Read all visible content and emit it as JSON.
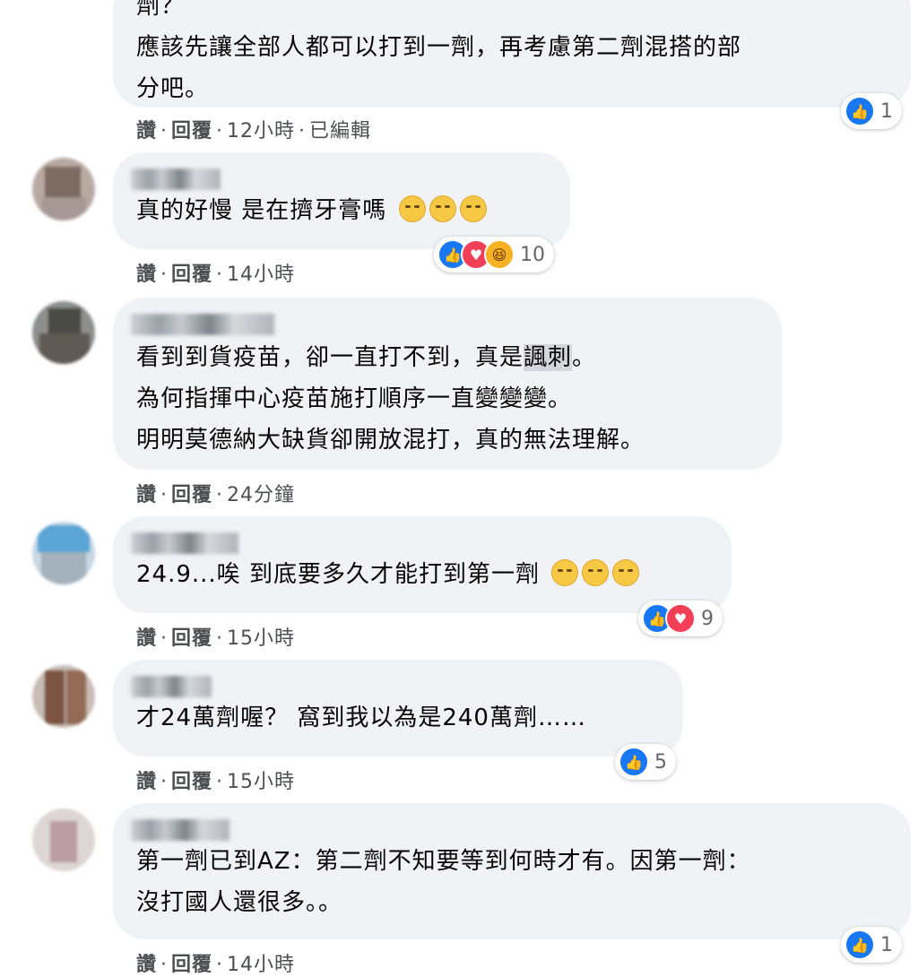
{
  "comments": [
    {
      "lines": [
        "劑？",
        "應該先讓全部人都可以打到一劑，再考慮第二劑混搭的部",
        "分吧。"
      ],
      "meta": {
        "like": "讚",
        "reply": "回覆",
        "time": "12小時",
        "edited": "已編輯"
      },
      "reactions": {
        "types": [
          "like"
        ],
        "count": "1"
      }
    },
    {
      "lines": [
        "真的好慢 是在擠牙膏嗎"
      ],
      "emojis": [
        "confused-face",
        "smirk-face",
        "smirk-face"
      ],
      "meta": {
        "like": "讚",
        "reply": "回覆",
        "time": "14小時"
      },
      "reactions": {
        "types": [
          "like",
          "love",
          "haha"
        ],
        "count": "10"
      }
    },
    {
      "line1_a": "看到到貨疫苗，卻一直打不到，真是",
      "line1_hl": "諷刺",
      "line1_b": "。",
      "lines": [
        "為何指揮中心疫苗施打順序一直變變變。",
        "明明莫德納大缺貨卻開放混打，真的無法理解。"
      ],
      "meta": {
        "like": "讚",
        "reply": "回覆",
        "time": "24分鐘"
      }
    },
    {
      "lines": [
        "24.9...唉 到底要多久才能打到第一劑"
      ],
      "emojis": [
        "expressionless-face",
        "expressionless-face",
        "expressionless-face"
      ],
      "meta": {
        "like": "讚",
        "reply": "回覆",
        "time": "15小時"
      },
      "reactions": {
        "types": [
          "like",
          "love"
        ],
        "count": "9"
      }
    },
    {
      "lines": [
        "才24萬劑喔？ 窩到我以為是240萬劑……"
      ],
      "meta": {
        "like": "讚",
        "reply": "回覆",
        "time": "15小時"
      },
      "reactions": {
        "types": [
          "like"
        ],
        "count": "5"
      }
    },
    {
      "lines": [
        "第一劑已到AZ：第二劑不知要等到何時才有。因第一劑：",
        "沒打國人還很多。。"
      ],
      "meta": {
        "like": "讚",
        "reply": "回覆",
        "time": "14小時"
      },
      "reactions": {
        "types": [
          "like"
        ],
        "count": "1"
      }
    }
  ]
}
